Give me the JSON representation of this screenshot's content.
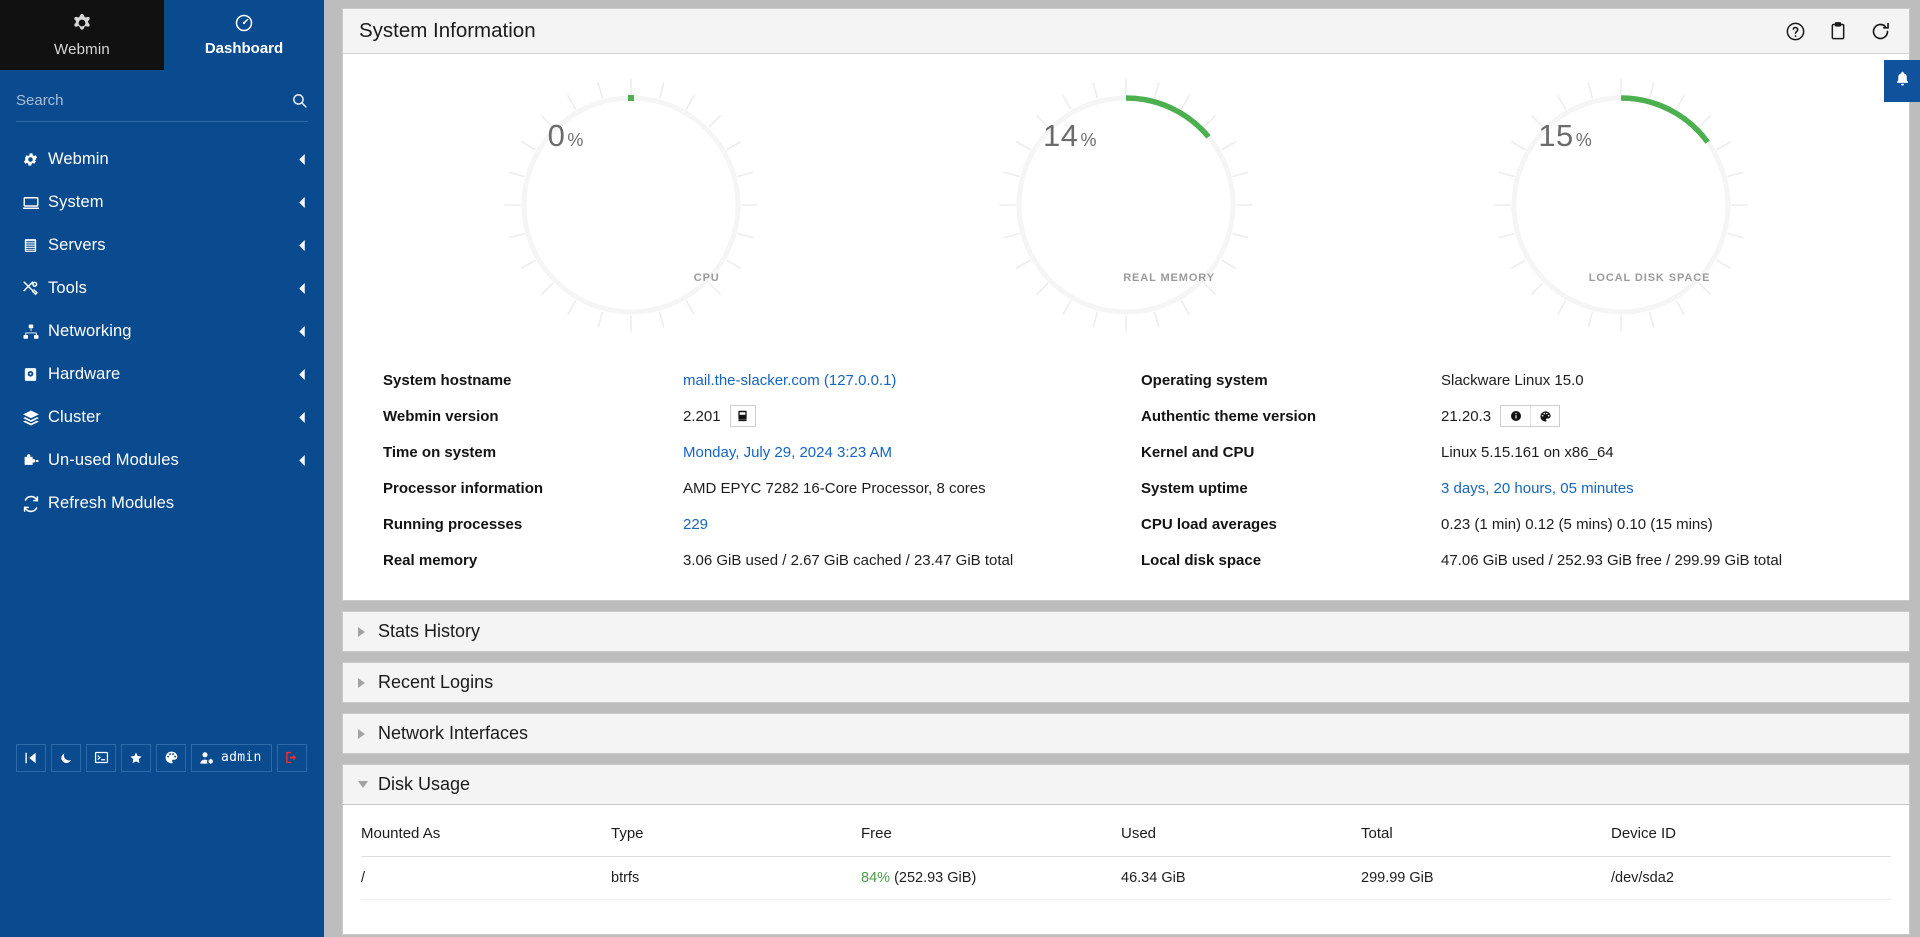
{
  "sidebar": {
    "brand_label": "Webmin",
    "dashboard_label": "Dashboard",
    "search_placeholder": "Search",
    "search_value": "",
    "nav": [
      {
        "label": "Webmin",
        "icon": "gear-icon",
        "expandable": true
      },
      {
        "label": "System",
        "icon": "monitor-icon",
        "expandable": true
      },
      {
        "label": "Servers",
        "icon": "server-icon",
        "expandable": true
      },
      {
        "label": "Tools",
        "icon": "tools-icon",
        "expandable": true
      },
      {
        "label": "Networking",
        "icon": "network-icon",
        "expandable": true
      },
      {
        "label": "Hardware",
        "icon": "harddrive-icon",
        "expandable": true
      },
      {
        "label": "Cluster",
        "icon": "layers-icon",
        "expandable": true
      },
      {
        "label": "Un-used Modules",
        "icon": "puzzle-icon",
        "expandable": true
      },
      {
        "label": "Refresh Modules",
        "icon": "refresh-icon",
        "expandable": false
      }
    ],
    "bottom_bar": {
      "collapse": "collapse-sidebar-icon",
      "theme_mode": "moon-icon",
      "terminal": "terminal-icon",
      "favorites": "star-icon",
      "palette": "palette-icon",
      "user_label": "admin",
      "logout": "logout-icon"
    }
  },
  "panel": {
    "title": "System Information",
    "tools": {
      "help": "help-icon",
      "clipboard": "clipboard-icon",
      "refresh": "refresh-icon"
    }
  },
  "notification": {
    "icon": "bell-icon"
  },
  "chart_data": [
    {
      "type": "gauge",
      "title": "CPU",
      "value": 0,
      "display": "0",
      "unit": "%",
      "ylim": [
        0,
        100
      ],
      "arc_color": "#4caf50",
      "track_color": "#f4f4f4"
    },
    {
      "type": "gauge",
      "title": "REAL MEMORY",
      "value": 14,
      "display": "14",
      "unit": "%",
      "ylim": [
        0,
        100
      ],
      "arc_color": "#4caf50",
      "track_color": "#f4f4f4"
    },
    {
      "type": "gauge",
      "title": "LOCAL DISK SPACE",
      "value": 15,
      "display": "15",
      "unit": "%",
      "ylim": [
        0,
        100
      ],
      "arc_color": "#4caf50",
      "track_color": "#f4f4f4"
    }
  ],
  "sysinfo": {
    "left": [
      {
        "key": "System hostname",
        "value": "mail.the-slacker.com (127.0.0.1)",
        "link": true
      },
      {
        "key": "Webmin version",
        "value": "2.201",
        "link": false,
        "badge": "changelog-icon"
      },
      {
        "key": "Time on system",
        "value": "Monday, July 29, 2024 3:23 AM",
        "link": true
      },
      {
        "key": "Processor information",
        "value": "AMD EPYC 7282 16-Core Processor, 8 cores",
        "link": false
      },
      {
        "key": "Running processes",
        "value": "229",
        "link": true
      },
      {
        "key": "Real memory",
        "value": "3.06 GiB used / 2.67 GiB cached / 23.47 GiB total",
        "link": false
      }
    ],
    "right": [
      {
        "key": "Operating system",
        "value": "Slackware Linux 15.0",
        "link": false
      },
      {
        "key": "Authentic theme version",
        "value": "21.20.3",
        "link": false,
        "badges": [
          "info-icon",
          "palette-icon"
        ]
      },
      {
        "key": "Kernel and CPU",
        "value": "Linux 5.15.161 on x86_64",
        "link": false
      },
      {
        "key": "System uptime",
        "value": "3 days, 20 hours, 05 minutes",
        "link": true
      },
      {
        "key": "CPU load averages",
        "value": "0.23 (1 min) 0.12 (5 mins) 0.10 (15 mins)",
        "link": false
      },
      {
        "key": "Local disk space",
        "value": "47.06 GiB used / 252.93 GiB free / 299.99 GiB total",
        "link": false
      }
    ]
  },
  "sections": [
    {
      "label": "Stats History",
      "expanded": false
    },
    {
      "label": "Recent Logins",
      "expanded": false
    },
    {
      "label": "Network Interfaces",
      "expanded": false
    },
    {
      "label": "Disk Usage",
      "expanded": true
    }
  ],
  "disk_usage": {
    "columns": [
      "Mounted As",
      "Type",
      "Free",
      "Used",
      "Total",
      "Device ID"
    ],
    "rows": [
      {
        "mounted_as": "/",
        "type": "btrfs",
        "free_pct": "84%",
        "free_size": "(252.93 GiB)",
        "used": "46.34 GiB",
        "total": "299.99 GiB",
        "device_id": "/dev/sda2"
      }
    ]
  },
  "colors": {
    "brand_blue": "#0a4a8f",
    "logo_black": "#111112",
    "accent_green": "#4caf50",
    "link_blue": "#1565c0",
    "page_gray": "#bdbdbd"
  }
}
